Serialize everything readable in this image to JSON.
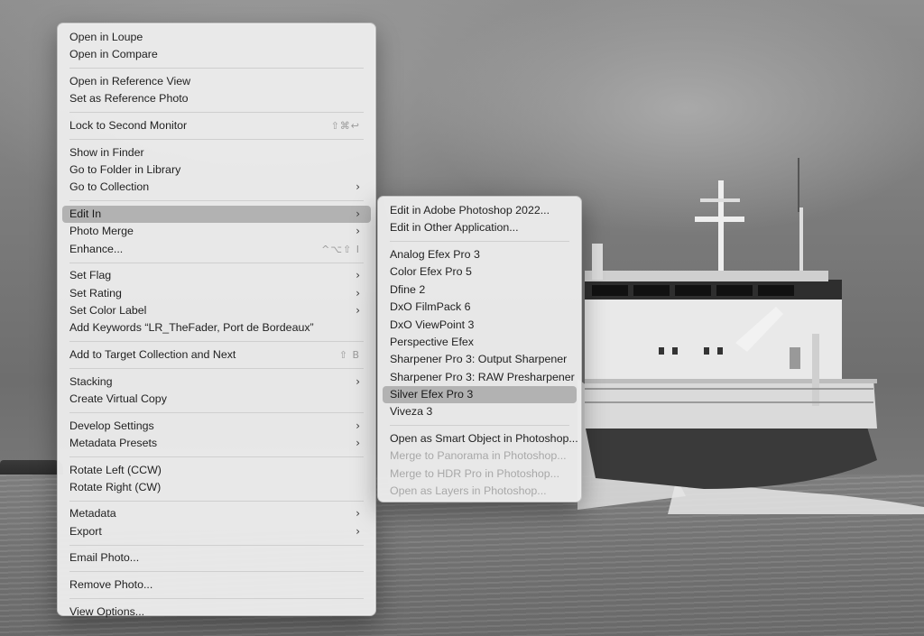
{
  "context_menu": {
    "groups": [
      [
        {
          "label": "Open in Loupe"
        },
        {
          "label": "Open in Compare"
        }
      ],
      [
        {
          "label": "Open in Reference View"
        },
        {
          "label": "Set as Reference Photo"
        }
      ],
      [
        {
          "label": "Lock to Second Monitor",
          "shortcut": "⇧⌘↩"
        }
      ],
      [
        {
          "label": "Show in Finder"
        },
        {
          "label": "Go to Folder in Library"
        },
        {
          "label": "Go to Collection",
          "submenu": true
        }
      ],
      [
        {
          "label": "Edit In",
          "submenu": true,
          "highlighted": true
        },
        {
          "label": "Photo Merge",
          "submenu": true
        },
        {
          "label": "Enhance...",
          "shortcut": "^⌥⇧ I"
        }
      ],
      [
        {
          "label": "Set Flag",
          "submenu": true
        },
        {
          "label": "Set Rating",
          "submenu": true
        },
        {
          "label": "Set Color Label",
          "submenu": true
        },
        {
          "label": "Add Keywords “LR_TheFader, Port de Bordeaux”"
        }
      ],
      [
        {
          "label": "Add to Target Collection and Next",
          "shortcut": "⇧ B"
        }
      ],
      [
        {
          "label": "Stacking",
          "submenu": true
        },
        {
          "label": "Create Virtual Copy"
        }
      ],
      [
        {
          "label": "Develop Settings",
          "submenu": true
        },
        {
          "label": "Metadata Presets",
          "submenu": true
        }
      ],
      [
        {
          "label": "Rotate Left (CCW)"
        },
        {
          "label": "Rotate Right (CW)"
        }
      ],
      [
        {
          "label": "Metadata",
          "submenu": true
        },
        {
          "label": "Export",
          "submenu": true
        }
      ],
      [
        {
          "label": "Email Photo..."
        }
      ],
      [
        {
          "label": "Remove Photo..."
        }
      ],
      [
        {
          "label": "View Options..."
        }
      ]
    ]
  },
  "edit_in_submenu": {
    "groups": [
      [
        {
          "label": "Edit in Adobe Photoshop 2022..."
        },
        {
          "label": "Edit in Other Application..."
        }
      ],
      [
        {
          "label": "Analog Efex Pro 3"
        },
        {
          "label": "Color Efex Pro 5"
        },
        {
          "label": "Dfine 2"
        },
        {
          "label": "DxO FilmPack 6"
        },
        {
          "label": "DxO ViewPoint 3"
        },
        {
          "label": "Perspective Efex"
        },
        {
          "label": "Sharpener Pro 3: Output Sharpener"
        },
        {
          "label": "Sharpener Pro 3: RAW Presharpener"
        },
        {
          "label": "Silver Efex Pro 3",
          "highlighted": true
        },
        {
          "label": "Viveza 3"
        }
      ],
      [
        {
          "label": "Open as Smart Object in Photoshop..."
        },
        {
          "label": "Merge to Panorama in Photoshop...",
          "disabled": true
        },
        {
          "label": "Merge to HDR Pro in Photoshop...",
          "disabled": true
        },
        {
          "label": "Open as Layers in Photoshop...",
          "disabled": true
        }
      ]
    ]
  },
  "icons": {
    "submenu_arrow": "chevron-right-icon"
  },
  "colors": {
    "menu_bg": "#ececec",
    "highlight": "#b2b2b2",
    "disabled_text": "#a8a8a8"
  }
}
